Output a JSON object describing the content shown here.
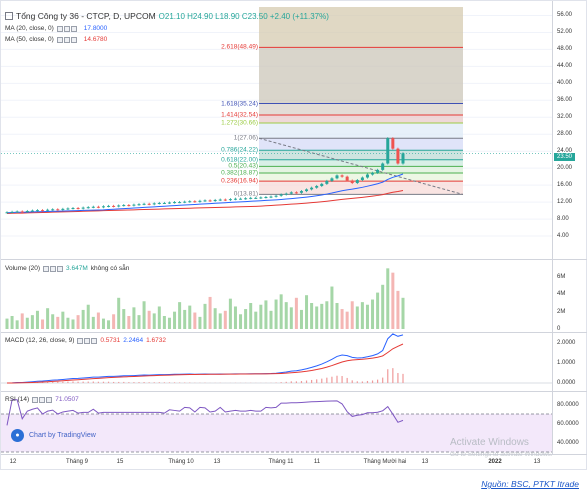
{
  "header": {
    "title": "Tổng Công ty 36 - CTCP, D, UPCOM",
    "ohlc": "O21.10 H24.90 L18.90 C23.50 +2.40 (+11.37%)"
  },
  "indicators": {
    "ma20": {
      "label": "MA (20, close, 0)",
      "value": "17.8000",
      "color": "#2962ff"
    },
    "ma50": {
      "label": "MA (50, close, 0)",
      "value": "14.6780",
      "color": "#e53935"
    },
    "volume": {
      "label": "Volume (20)",
      "value": "3.647M",
      "extra": "không có sẵn"
    },
    "macd": {
      "label": "MACD (12, 26, close, 9)",
      "v1": "0.5731",
      "v2": "2.2464",
      "v3": "1.6732"
    },
    "rsi": {
      "label": "RSI (14)",
      "value": "71.0507"
    }
  },
  "fib_levels": [
    {
      "label": "2.618(48.49)",
      "price": 48.49,
      "color": "#e53935"
    },
    {
      "label": "1.618(35.24)",
      "price": 35.24,
      "color": "#3f51b5"
    },
    {
      "label": "1.414(32.54)",
      "price": 32.54,
      "color": "#e53935"
    },
    {
      "label": "1.272(30.66)",
      "price": 30.66,
      "color": "#9ccc45"
    },
    {
      "label": "1(27.06)",
      "price": 27.06,
      "color": "#787b86"
    },
    {
      "label": "0.786(24.22)",
      "price": 24.22,
      "color": "#26a69a"
    },
    {
      "label": "0.618(22.00)",
      "price": 22.0,
      "color": "#26a69a"
    },
    {
      "label": "0.5(20.43)",
      "price": 20.43,
      "color": "#4caf50"
    },
    {
      "label": "0.382(18.87)",
      "price": 18.87,
      "color": "#4caf50"
    },
    {
      "label": "0.236(16.94)",
      "price": 16.94,
      "color": "#e53935"
    },
    {
      "label": "0(13.81)",
      "price": 13.81,
      "color": "#787b86"
    }
  ],
  "price_axis": [
    "56.00",
    "52.00",
    "48.00",
    "44.00",
    "40.00",
    "36.00",
    "32.00",
    "28.00",
    "24.00",
    "20.00",
    "16.00",
    "12.00",
    "8.00",
    "4.00"
  ],
  "price_tag": "23.50",
  "volume_axis": [
    "6M",
    "4M",
    "2M",
    "0"
  ],
  "macd_axis": [
    "2.0000",
    "1.0000",
    "0.0000"
  ],
  "rsi_axis": [
    "80.0000",
    "60.0000",
    "40.0000"
  ],
  "time_axis": [
    "12",
    "Tháng 9",
    "15",
    "Tháng 10",
    "13",
    "Tháng 11",
    "11",
    "Tháng Mười hai",
    "13",
    "2022",
    "13"
  ],
  "tv_logo_text": "Chart by TradingView",
  "watermark": {
    "line1": "Activate Windows",
    "line2": "Go to Settings to activate Windows."
  },
  "credit": "Nguồn: BSC, PTKT Itrade",
  "chart_data": {
    "type": "candlestick",
    "price_closes": [
      9.6,
      9.7,
      9.8,
      9.7,
      9.9,
      10.0,
      10.1,
      10.0,
      10.2,
      10.3,
      10.2,
      10.4,
      10.5,
      10.6,
      10.5,
      10.7,
      10.8,
      10.9,
      10.8,
      11.0,
      11.1,
      11.0,
      11.2,
      11.3,
      11.2,
      11.4,
      11.5,
      11.6,
      11.5,
      11.7,
      11.8,
      11.8,
      11.9,
      12.0,
      12.0,
      12.1,
      12.2,
      12.1,
      12.3,
      12.4,
      12.3,
      12.5,
      12.6,
      12.5,
      12.7,
      12.8,
      12.8,
      12.9,
      13.0,
      13.0,
      13.1,
      13.2,
      13.3,
      13.5,
      13.8,
      14.0,
      14.3,
      14.2,
      14.6,
      15.0,
      15.4,
      15.8,
      16.3,
      17.0,
      17.6,
      18.3,
      18.0,
      17.1,
      16.5,
      17.2,
      17.8,
      18.5,
      18.9,
      19.6,
      21.1,
      27.06,
      24.6,
      21.1,
      23.5
    ],
    "volumes_millions": [
      1.2,
      1.5,
      1.0,
      1.8,
      1.3,
      1.6,
      2.1,
      1.1,
      2.4,
      1.7,
      1.4,
      2.0,
      1.3,
      1.1,
      1.6,
      2.2,
      2.8,
      1.4,
      1.9,
      1.2,
      1.0,
      1.7,
      3.6,
      2.3,
      1.5,
      2.5,
      1.6,
      3.2,
      2.1,
      1.8,
      2.6,
      1.5,
      1.3,
      2.0,
      3.1,
      2.2,
      2.7,
      1.9,
      1.4,
      2.9,
      3.7,
      2.4,
      1.8,
      2.1,
      3.5,
      2.6,
      1.7,
      2.3,
      3.0,
      2.0,
      2.8,
      3.3,
      2.1,
      3.4,
      4.0,
      3.1,
      2.5,
      3.6,
      2.2,
      3.9,
      3.0,
      2.6,
      2.9,
      3.2,
      4.9,
      3.0,
      2.3,
      2.0,
      3.2,
      2.6,
      3.1,
      2.8,
      3.4,
      4.2,
      5.1,
      7.0,
      6.5,
      4.4,
      3.6
    ],
    "macd_range": [
      -0.2,
      2.2
    ],
    "rsi_range": [
      30,
      90
    ],
    "price_range": [
      0,
      58
    ],
    "volume_range": [
      0,
      7.5
    ]
  }
}
